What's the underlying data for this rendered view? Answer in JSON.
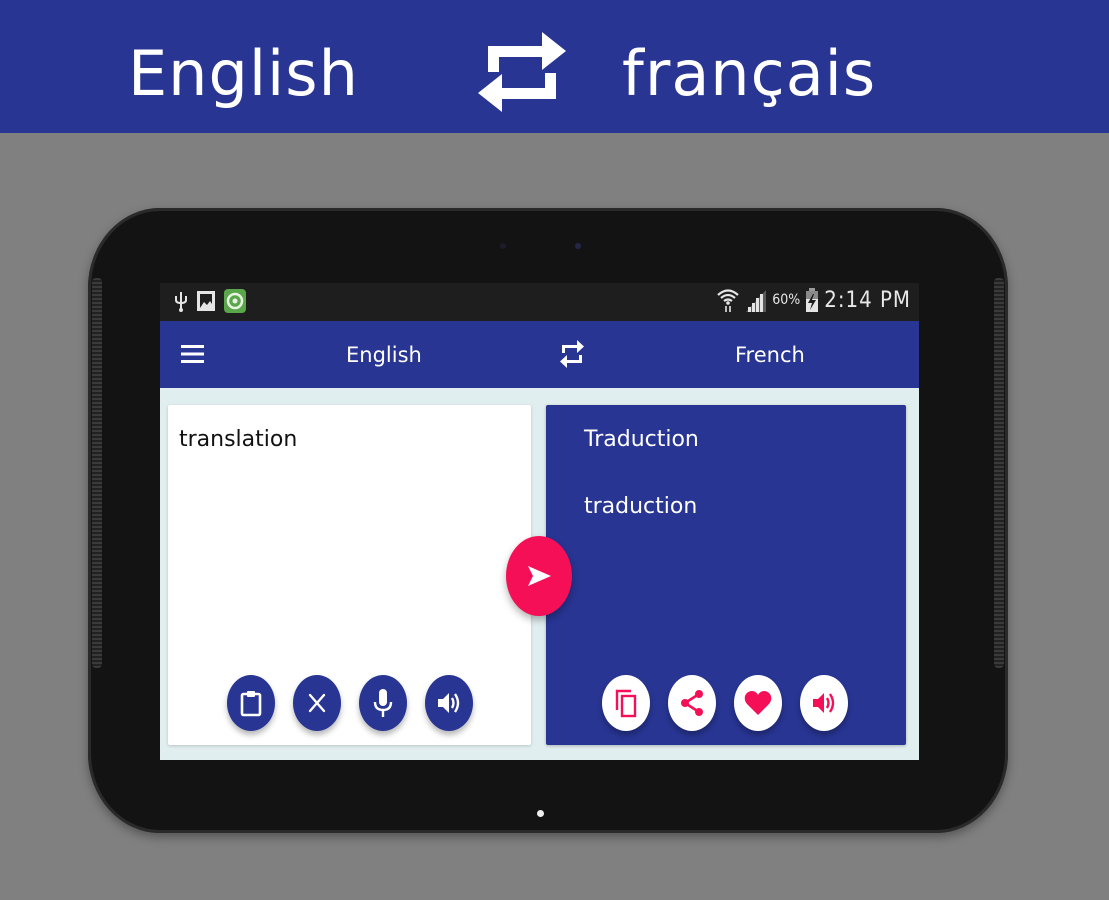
{
  "banner": {
    "source_language": "English",
    "target_language": "français",
    "swap_icon": "swap-arrows-icon"
  },
  "status_bar": {
    "left_icons": [
      "usb-icon",
      "gallery-icon",
      "app-notification-icon"
    ],
    "wifi_icon": "wifi-icon",
    "signal_icon": "signal-icon",
    "battery_percent": "60%",
    "battery_icon": "battery-charging-icon",
    "time": "2:14 PM"
  },
  "app_bar": {
    "menu_icon": "hamburger-menu-icon",
    "source_language": "English",
    "swap_icon": "swap-arrows-icon",
    "target_language": "French"
  },
  "input_card": {
    "text": "translation",
    "actions": [
      {
        "name": "paste",
        "icon": "clipboard-icon"
      },
      {
        "name": "clear",
        "icon": "close-icon"
      },
      {
        "name": "voice-input",
        "icon": "microphone-icon"
      },
      {
        "name": "speak",
        "icon": "speaker-icon"
      }
    ]
  },
  "translate_button": {
    "icon": "send-icon"
  },
  "output_card": {
    "lines": [
      "Traduction",
      "traduction"
    ],
    "actions": [
      {
        "name": "copy",
        "icon": "copy-icon"
      },
      {
        "name": "share",
        "icon": "share-icon"
      },
      {
        "name": "favorite",
        "icon": "heart-icon"
      },
      {
        "name": "speak",
        "icon": "speaker-icon"
      }
    ]
  },
  "colors": {
    "primary": "#283593",
    "accent": "#f50f57",
    "background": "#e1eef0",
    "page_gray": "#808080"
  }
}
